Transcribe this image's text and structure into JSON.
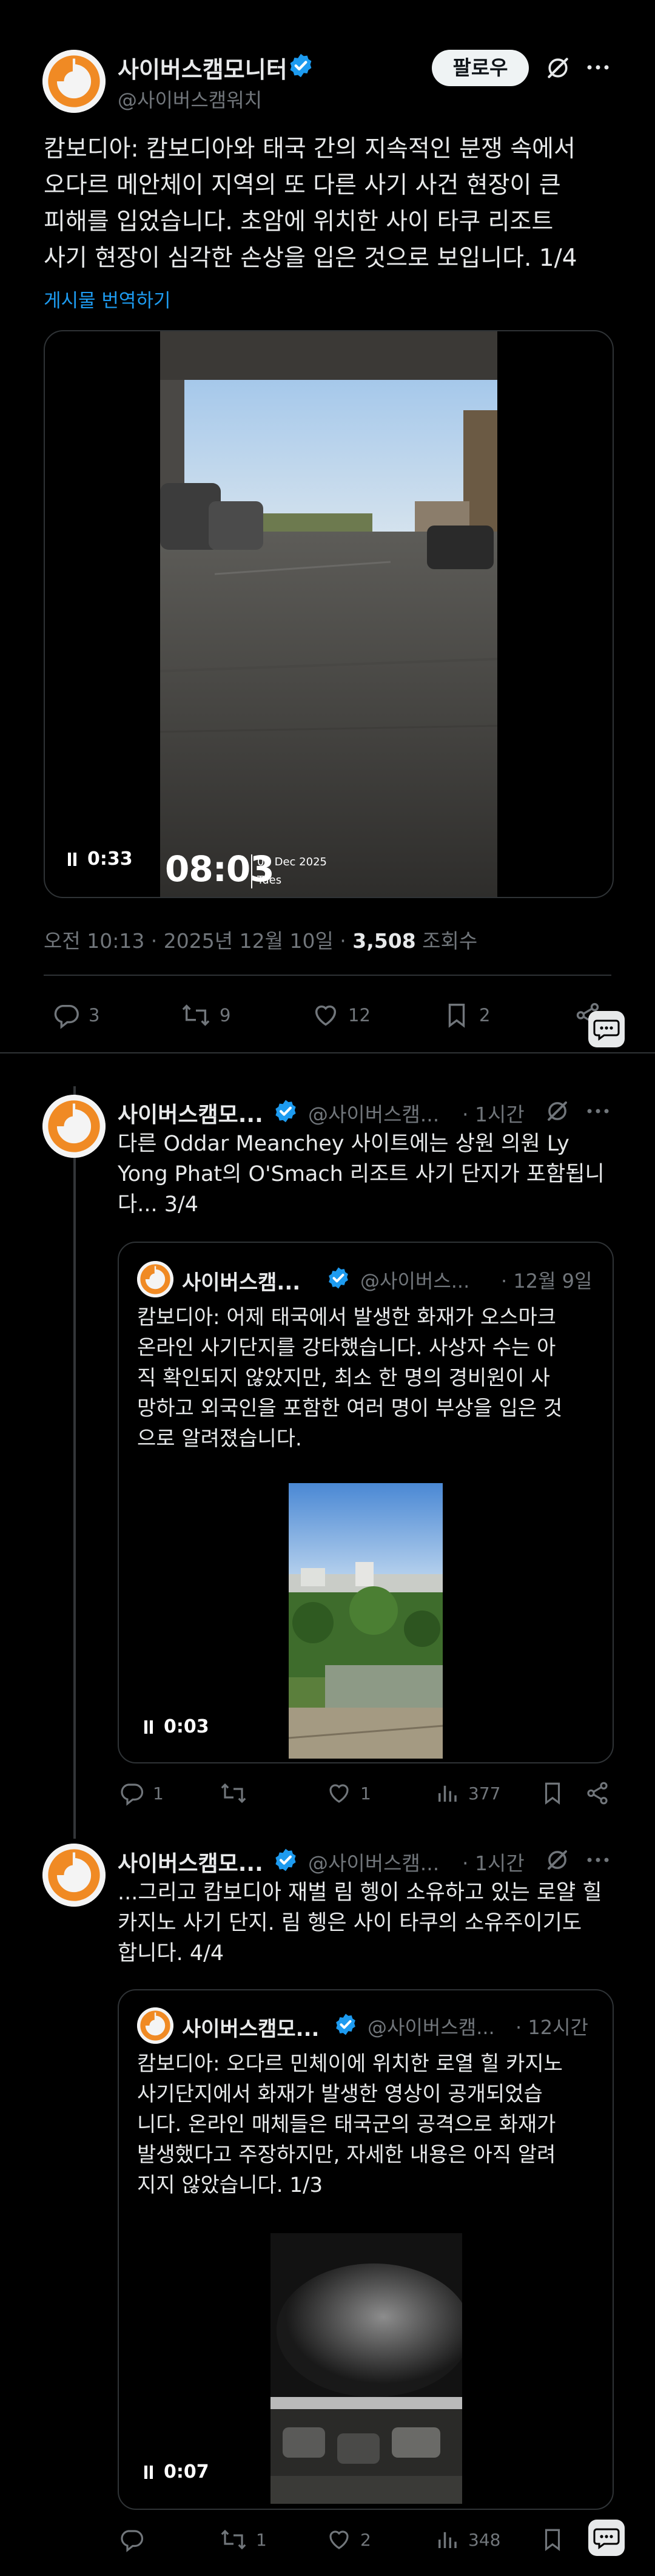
{
  "colors": {
    "background": "#000000",
    "text": "#e7e9ea",
    "secondary": "#71767b",
    "link": "#1d9bf0",
    "verified": "#1d9bf0",
    "border": "#2f3336"
  },
  "main_post": {
    "name": "사이버스캠모니터",
    "handle": "@사이버스캠워치",
    "follow_label": "팔로우",
    "text": "캄보디아: 캄보디아와 태국 간의 지속적인 분쟁 속에서\n오다르 메안체이 지역의 또 다른 사기 사건 현장이 큰\n피해를 입었습니다. 초암에 위치한 사이 타쿠 리조트\n사기 현장이 심각한 손상을 입은 것으로 보입니다. 1/4",
    "translate_label": "게시물 번역하기",
    "video": {
      "duration": "0:33",
      "overlay_time": "08:03",
      "overlay_date": "09 Dec 2025",
      "overlay_day": "Tues"
    },
    "timestamp": "오전 10:13 · 2025년 12월 10일 · ",
    "views_count": "3,508",
    "views_label": " 조회수",
    "actions": {
      "replies": "3",
      "reposts": "9",
      "likes": "12",
      "bookmarks": "2"
    }
  },
  "reply_1": {
    "name": "사이버스캠모...",
    "handle": "@사이버스캠...",
    "time": "· 1시간",
    "text": "다른 Oddar Meanchey 사이트에는 상원 의원 Ly\nYong Phat의 O'Smach 리조트 사기 단지가 포함됩니\n다... 3/4",
    "quote": {
      "name": "사이버스캠...",
      "handle": "@사이버스...",
      "time": "· 12월 9일",
      "text": "캄보디아: 어제 태국에서 발생한 화재가 오스마크\n온라인 사기단지를 강타했습니다. 사상자 수는 아\n직 확인되지 않았지만, 최소 한 명의 경비원이 사\n망하고 외국인을 포함한 여러 명이 부상을 입은 것\n으로 알려졌습니다.",
      "video_duration": "0:03"
    },
    "actions": {
      "replies": "1",
      "reposts": "",
      "likes": "1",
      "views": "377"
    }
  },
  "reply_2": {
    "name": "사이버스캠모...",
    "handle": "@사이버스캠...",
    "time": "· 1시간",
    "text": "...그리고 캄보디아 재벌 림 헹이 소유하고 있는 로얄 힐\n카지노 사기 단지. 림 헹은 사이 타쿠의 소유주이기도\n합니다. 4/4",
    "quote": {
      "name": "사이버스캠모...",
      "handle": "@사이버스캠...",
      "time": "· 12시간",
      "text": "캄보디아: 오다르 민체이에 위치한 로열 힐 카지노\n사기단지에서 화재가 발생한 영상이 공개되었습\n니다. 온라인 매체들은 태국군의 공격으로 화재가\n발생했다고 주장하지만, 자세한 내용은 아직 알려\n지지 않았습니다. 1/3",
      "video_duration": "0:07"
    },
    "actions": {
      "replies": "",
      "reposts": "1",
      "likes": "2",
      "views": "348"
    }
  }
}
